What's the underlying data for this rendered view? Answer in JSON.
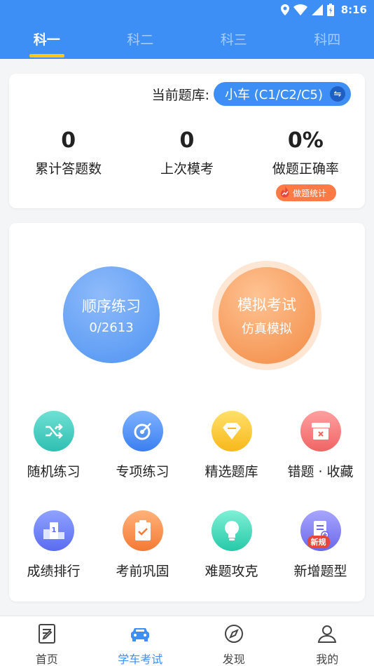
{
  "status": {
    "time": "8:16"
  },
  "tabs": [
    {
      "label": "科一",
      "active": true
    },
    {
      "label": "科二",
      "active": false
    },
    {
      "label": "科三",
      "active": false
    },
    {
      "label": "科四",
      "active": false
    }
  ],
  "bank": {
    "label": "当前题库:",
    "value": "小车 (C1/C2/C5)"
  },
  "stats": [
    {
      "value": "0",
      "label": "累计答题数"
    },
    {
      "value": "0",
      "label": "上次模考"
    },
    {
      "value": "0%",
      "label": "做题正确率"
    }
  ],
  "stat_badge": "做题统计",
  "practice": {
    "title": "顺序练习",
    "progress": "0/2613"
  },
  "exam": {
    "title": "模拟考试",
    "sub": "仿真模拟"
  },
  "grid": [
    {
      "label": "随机练习",
      "icon": "shuffle-icon"
    },
    {
      "label": "专项练习",
      "icon": "target-icon"
    },
    {
      "label": "精选题库",
      "icon": "gem-icon"
    },
    {
      "label": "错题 · 收藏",
      "icon": "box-icon"
    },
    {
      "label": "成绩排行",
      "icon": "podium-icon"
    },
    {
      "label": "考前巩固",
      "icon": "clipboard-check-icon"
    },
    {
      "label": "难题攻克",
      "icon": "bulb-icon"
    },
    {
      "label": "新增题型",
      "icon": "doc-plus-icon",
      "tag": "新规"
    }
  ],
  "nav": [
    {
      "label": "首页",
      "icon": "doc-edit-icon",
      "active": false
    },
    {
      "label": "学车考试",
      "icon": "car-icon",
      "active": true
    },
    {
      "label": "发现",
      "icon": "compass-icon",
      "active": false
    },
    {
      "label": "我的",
      "icon": "user-icon",
      "active": false
    }
  ],
  "colors": {
    "primary": "#3d8ef5",
    "accent": "#ffc515",
    "orange": "#f28a44"
  }
}
